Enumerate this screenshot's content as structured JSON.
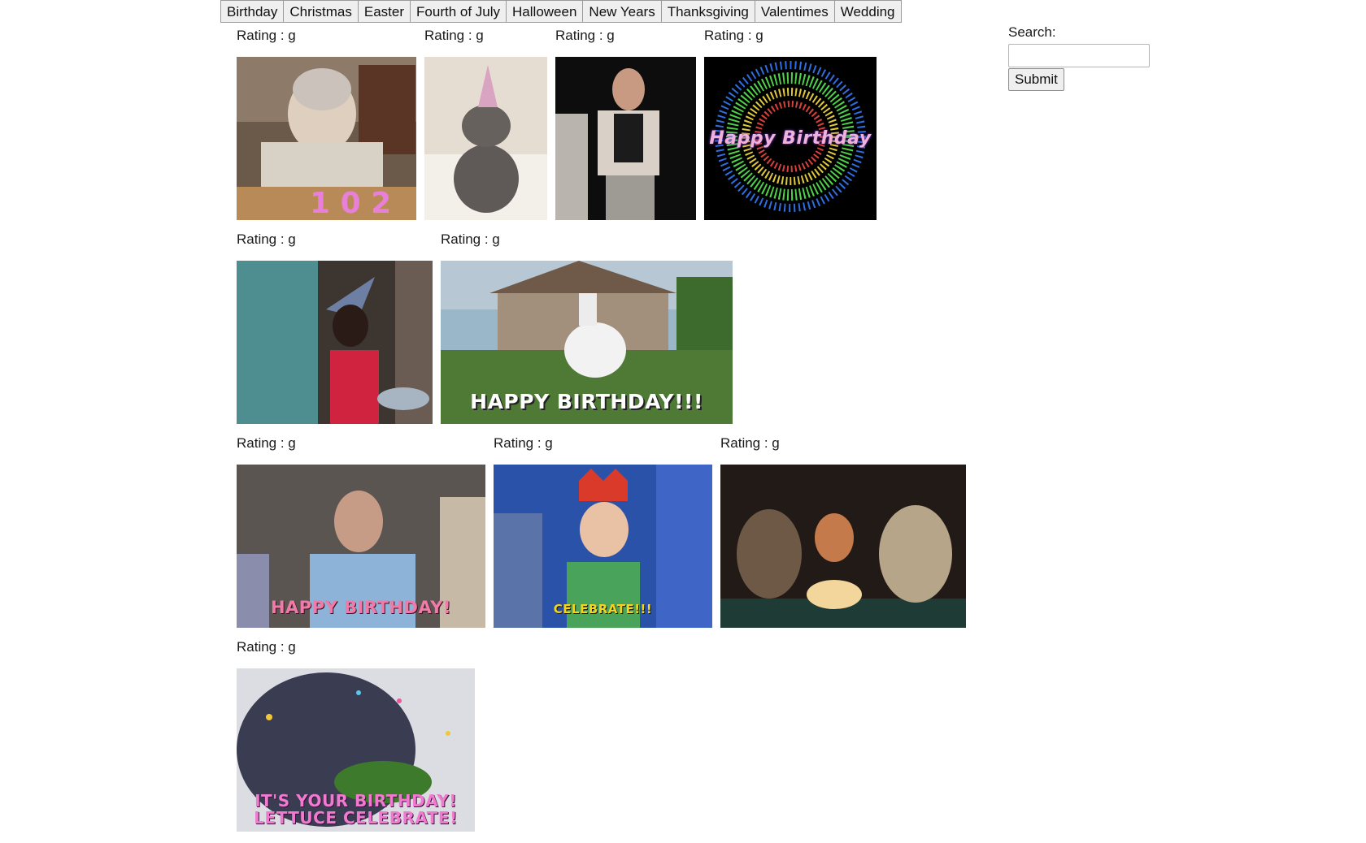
{
  "tabs": [
    "Birthday",
    "Christmas",
    "Easter",
    "Fourth of July",
    "Halloween",
    "New Years",
    "Thanksgiving",
    "Valentimes",
    "Wedding"
  ],
  "search": {
    "label": "Search:",
    "value": "",
    "submit_label": "Submit"
  },
  "gifs": [
    {
      "rating": "Rating : g",
      "caption": ""
    },
    {
      "rating": "Rating : g",
      "caption": ""
    },
    {
      "rating": "Rating : g",
      "caption": ""
    },
    {
      "rating": "Rating : g",
      "caption": "Happy Birthday"
    },
    {
      "rating": "Rating : g",
      "caption": ""
    },
    {
      "rating": "Rating : g",
      "caption": "HAPPY BIRTHDAY!!!"
    },
    {
      "rating": "Rating : g",
      "caption": "HAPPY BIRTHDAY!"
    },
    {
      "rating": "Rating : g",
      "caption": "CELEBRATE!!!"
    },
    {
      "rating": "Rating : g",
      "caption": ""
    },
    {
      "rating": "Rating : g",
      "caption": "IT'S YOUR BIRTHDAY! LETTUCE CELEBRATE!"
    }
  ],
  "colors": {
    "tab_bg": "#efefef",
    "tab_border": "#9a9a9a",
    "text": "#1a1a1a"
  }
}
